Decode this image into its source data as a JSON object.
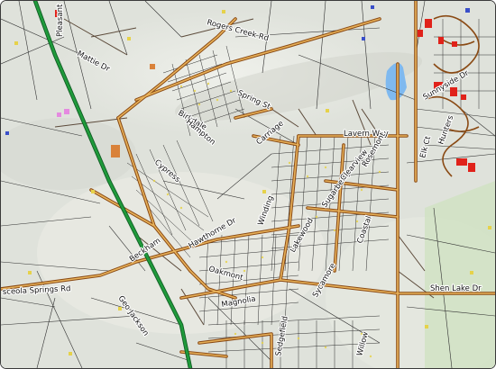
{
  "map": {
    "colors": {
      "terrain": "#dfe2db",
      "terrain_shade": "#c9ccc4",
      "green_area": "#cfe2c2",
      "water": "#7fb9ef",
      "highway": "#1f9a3b",
      "major_road": "#8a4a14",
      "major_road_fill": "#e8b25a",
      "minor_road": "#5c4a3a",
      "parcel": "#2f2f2f",
      "building_red": "#e0221a",
      "building_yellow": "#e6d24a",
      "building_orange": "#d9823a",
      "building_pink": "#e58ae0",
      "building_blue": "#3a4fc9"
    },
    "labels": {
      "pleasant": "Pleasant",
      "rogers_creek_rd": "Rogers Creek Rd",
      "mattie_dr": "Mattie Dr",
      "spring_st": "Spring St",
      "birkdale": "Birkdale",
      "carriage": "Carriage",
      "lavern_way": "Lavern Way",
      "sunnyside_dr": "Sunnyside Dr",
      "elk_ct": "Elk Ct",
      "hunters": "Hunters",
      "beckham": "Beckham",
      "hawthorne_dr": "Hawthorne Dr",
      "osceola_springs_rd": "sceola Springs Rd",
      "geo_jackson": "Geo Jackson",
      "shen_lake_dr": "Shen Lake Dr",
      "winding": "Winding",
      "lakewood": "Lakewood",
      "sugarberry": "Sugarberry",
      "clearview": "Clearview",
      "rosemont": "Rosemont",
      "coastal": "Coastal",
      "cypress": "Cypress",
      "oakmont": "Oakmont",
      "magnolia": "Magnolia",
      "sycamore": "Sycamore",
      "willow": "Willow",
      "sedgefield": "Sedgefield",
      "hampton": "Hampton"
    }
  }
}
